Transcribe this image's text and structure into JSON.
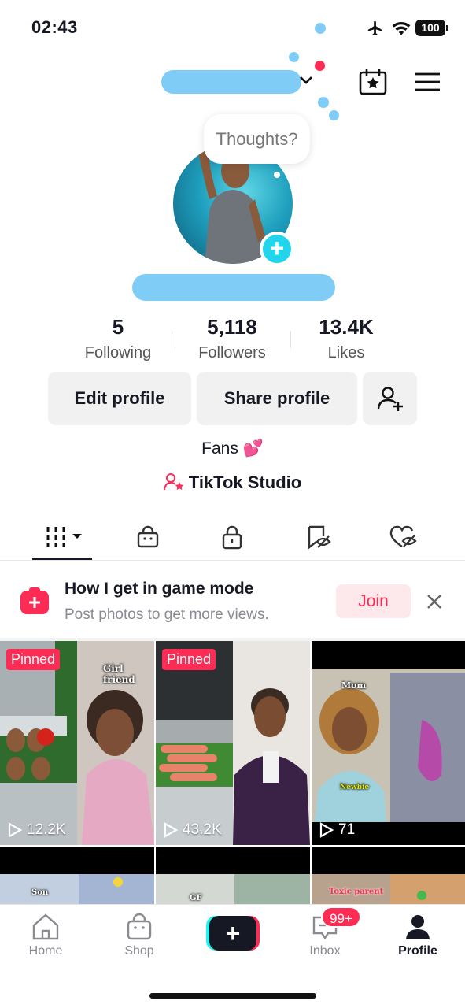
{
  "status_bar": {
    "time": "02:43",
    "battery": "100"
  },
  "bubble": {
    "text": "Thoughts?"
  },
  "stats": [
    {
      "value": "5",
      "label": "Following"
    },
    {
      "value": "5,118",
      "label": "Followers"
    },
    {
      "value": "13.4K",
      "label": "Likes"
    }
  ],
  "actions": {
    "edit": "Edit profile",
    "share": "Share profile"
  },
  "bio": {
    "text": "Fans 💕",
    "studio": "TikTok Studio"
  },
  "promo": {
    "title": "How I get in game mode",
    "subtitle": "Post photos to get more views.",
    "join": "Join"
  },
  "videos": [
    {
      "pinned": "Pinned",
      "views": "12.2K",
      "caption": "Girl friend"
    },
    {
      "pinned": "Pinned",
      "views": "43.2K"
    },
    {
      "views": "71",
      "caption": "Mom",
      "caption2": "Newbie"
    },
    {
      "caption": "Son"
    },
    {
      "caption": "GF"
    },
    {
      "caption": "Toxic parent"
    }
  ],
  "nav": {
    "home": "Home",
    "shop": "Shop",
    "inbox": "Inbox",
    "inbox_badge": "99+",
    "profile": "Profile"
  },
  "colors": {
    "accent": "#fe2c55",
    "teal": "#20d5ec",
    "redaction": "#7fcdf7"
  }
}
